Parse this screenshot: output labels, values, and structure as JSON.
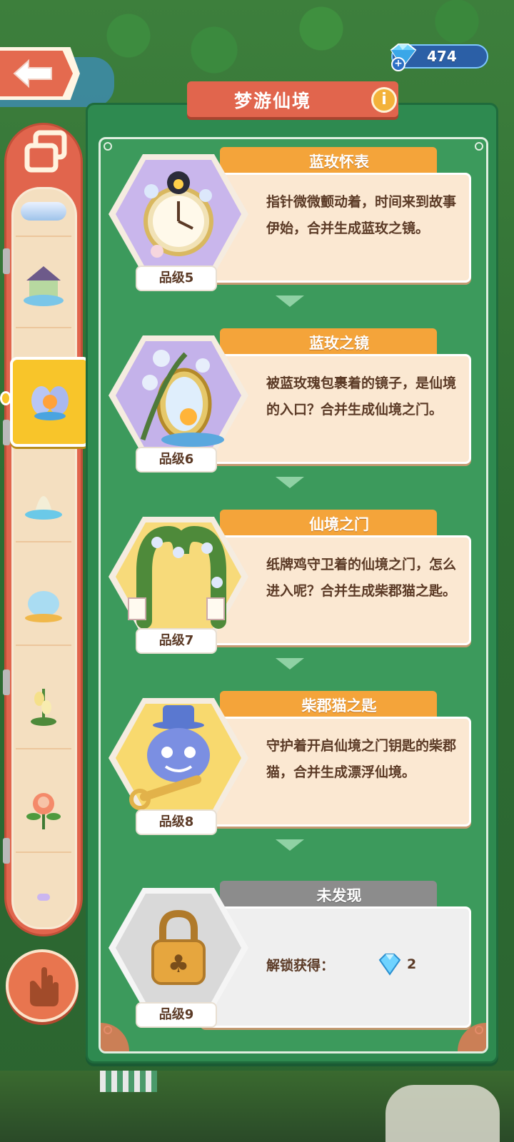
{
  "header": {
    "title": "梦游仙境",
    "info_icon": "i",
    "gem_count": "474"
  },
  "sidebar": {
    "items": [
      {
        "name": "sidebar-item-1",
        "icon": "castle-thumb"
      },
      {
        "name": "sidebar-item-2",
        "icon": "carousel-thumb"
      },
      {
        "name": "sidebar-item-3",
        "icon": "fairy-thumb",
        "selected": true
      },
      {
        "name": "sidebar-item-4",
        "icon": "fountain-thumb"
      },
      {
        "name": "sidebar-item-5",
        "icon": "teapot-thumb"
      },
      {
        "name": "sidebar-item-6",
        "icon": "lily-thumb"
      },
      {
        "name": "sidebar-item-7",
        "icon": "rose-thumb"
      },
      {
        "name": "sidebar-item-8",
        "icon": "petal-thumb"
      }
    ]
  },
  "cards": [
    {
      "name": "蓝玫怀表",
      "desc": "指针微微颤动着，时间来到故事伊始，合并生成蓝玫之镜。",
      "grade": "品级5",
      "theme": "#c9b6ec"
    },
    {
      "name": "蓝玫之镜",
      "desc": "被蓝玫瑰包裹着的镜子，是仙境的入口？合并生成仙境之门。",
      "grade": "品级6",
      "theme": "#c4b2ea"
    },
    {
      "name": "仙境之门",
      "desc": "纸牌鸡守卫着的仙境之门，怎么进入呢？合并生成柴郡猫之匙。",
      "grade": "品级7",
      "theme": "#f7da7a"
    },
    {
      "name": "柴郡猫之匙",
      "desc": "守护着开启仙境之门钥匙的柴郡猫，合并生成漂浮仙境。",
      "grade": "品级8",
      "theme": "#f8d96e"
    }
  ],
  "locked_card": {
    "name": "未发现",
    "unlock_label": "解锁获得：",
    "reward_count": "2",
    "grade": "品级9"
  },
  "colors": {
    "panel_green": "#2e8a50",
    "title_red": "#e1654d",
    "tab_orange": "#f4a43a",
    "card_cream": "#fbe8d2",
    "text_brown": "#5b3a26"
  }
}
